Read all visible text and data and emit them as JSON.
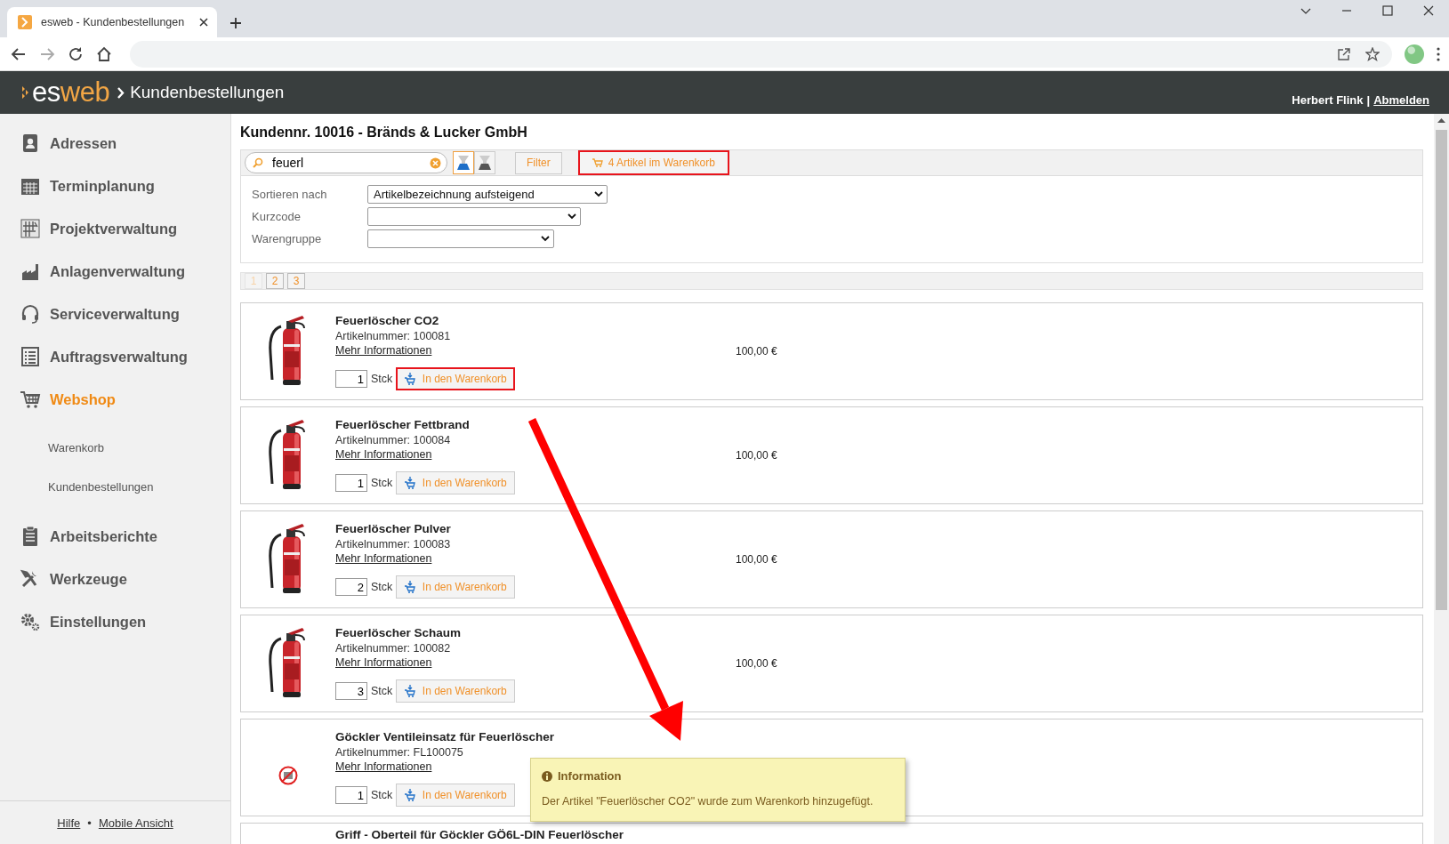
{
  "browser": {
    "tab_title": "esweb - Kundenbestellungen"
  },
  "header": {
    "logo_prefix": "es",
    "logo_suffix": "web",
    "title": "Kundenbestellungen",
    "user": "Herbert Flink",
    "separator": "|",
    "logout": "Abmelden"
  },
  "sidebar": {
    "items": [
      {
        "label": "Adressen",
        "selected": false
      },
      {
        "label": "Terminplanung",
        "selected": false
      },
      {
        "label": "Projektverwaltung",
        "selected": false
      },
      {
        "label": "Anlagenverwaltung",
        "selected": false
      },
      {
        "label": "Serviceverwaltung",
        "selected": false
      },
      {
        "label": "Auftragsverwaltung",
        "selected": false
      },
      {
        "label": "Webshop",
        "selected": true,
        "children": [
          {
            "label": "Warenkorb"
          },
          {
            "label": "Kundenbestellungen"
          }
        ]
      },
      {
        "label": "Arbeitsberichte",
        "selected": false
      },
      {
        "label": "Werkzeuge",
        "selected": false
      },
      {
        "label": "Einstellungen",
        "selected": false
      }
    ],
    "footer": {
      "links": [
        "Hilfe",
        "Mobile Ansicht"
      ],
      "separator": "•"
    }
  },
  "customer_heading": "Kundennr. 10016 - Bränds & Lucker GmbH",
  "search": {
    "value": "feuerl"
  },
  "view_toggles": [
    {
      "selected": true
    },
    {
      "selected": false
    }
  ],
  "filter_button": "Filter",
  "cart_button": {
    "label": "4 Artikel im Warenkorb",
    "highlighted": true
  },
  "filters": [
    {
      "label": "Sortieren nach",
      "value": "Artikelbezeichnung aufsteigend"
    },
    {
      "label": "Kurzcode"
    },
    {
      "label": "Warengruppe"
    }
  ],
  "pagination": [
    {
      "label": "1",
      "selected": true
    },
    {
      "label": "2",
      "selected": false
    },
    {
      "label": "3",
      "selected": false
    }
  ],
  "products": [
    {
      "name": "Feuerlöscher CO2",
      "article_number": "Artikelnummer: 100081",
      "more_link": "Mehr Informationen",
      "quantity": "1",
      "unit": "Stck",
      "add_button": "In den Warenkorb",
      "price": "100,00 €",
      "highlighted": true
    },
    {
      "name": "Feuerlöscher Fettbrand",
      "article_number": "Artikelnummer: 100084",
      "more_link": "Mehr Informationen",
      "quantity": "1",
      "unit": "Stck",
      "add_button": "In den Warenkorb",
      "price": "100,00 €",
      "highlighted": false
    },
    {
      "name": "Feuerlöscher Pulver",
      "article_number": "Artikelnummer: 100083",
      "more_link": "Mehr Informationen",
      "quantity": "2",
      "unit": "Stck",
      "add_button": "In den Warenkorb",
      "price": "100,00 €",
      "highlighted": false
    },
    {
      "name": "Feuerlöscher Schaum",
      "article_number": "Artikelnummer: 100082",
      "more_link": "Mehr Informationen",
      "quantity": "3",
      "unit": "Stck",
      "add_button": "In den Warenkorb",
      "price": "100,00 €",
      "highlighted": false
    },
    {
      "kind": "no-image",
      "name": "Göckler Ventileinsatz für Feuerlöscher",
      "article_number": "Artikelnummer: FL100075",
      "more_link": "Mehr Informationen",
      "quantity": "1",
      "unit": "Stck",
      "add_button": "In den Warenkorb",
      "highlighted": false
    },
    {
      "kind": "partial",
      "name": "Griff - Oberteil für Göckler GÖ6L-DIN Feuerlöscher"
    }
  ],
  "toast": {
    "title": "Information",
    "message": "Der Artikel \"Feuerlöscher CO2\" wurde zum Warenkorb hinzugefügt."
  }
}
